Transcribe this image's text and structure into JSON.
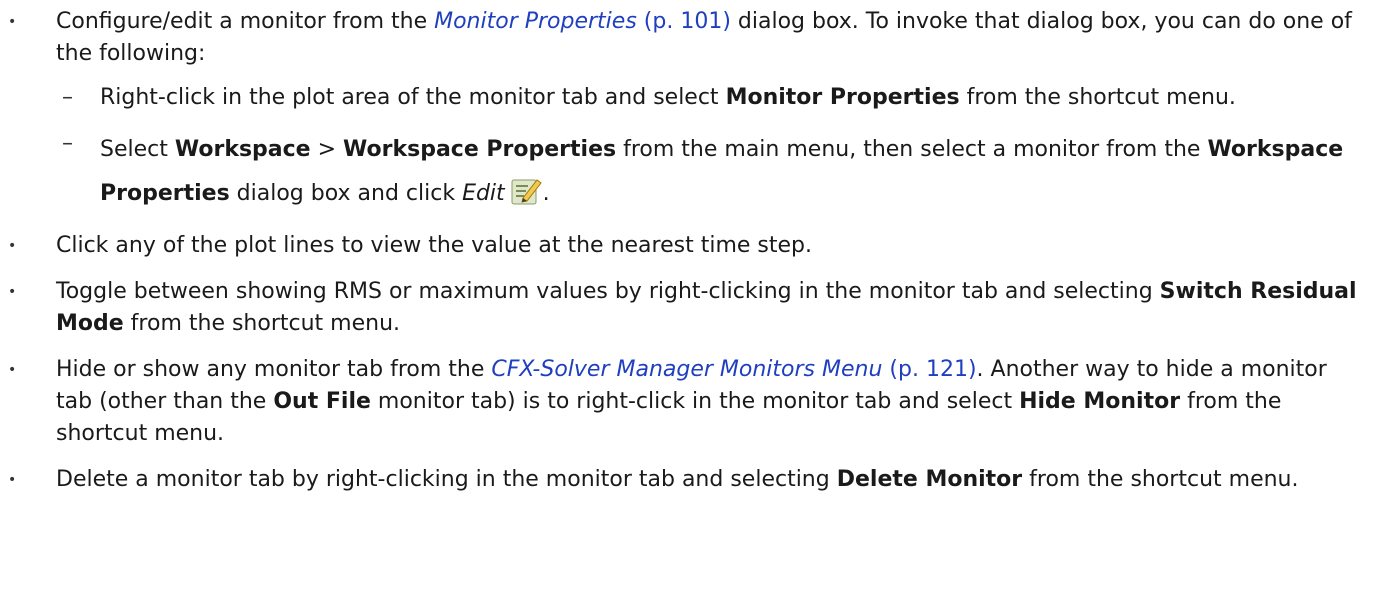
{
  "items": [
    {
      "parts": [
        {
          "t": "Configure/edit a monitor from the "
        },
        {
          "link": "Monitor Properties",
          "page": "(p. 101)"
        },
        {
          "t": " dialog box. To invoke that dialog box, you can do one of the following:"
        }
      ],
      "sub": [
        {
          "parts": [
            {
              "t": "Right-click in the plot area of the monitor tab and select "
            },
            {
              "b": "Monitor Properties"
            },
            {
              "t": " from the shortcut menu."
            }
          ]
        },
        {
          "parts": [
            {
              "t": "Select "
            },
            {
              "b": "Workspace"
            },
            {
              "t": " > "
            },
            {
              "b": "Workspace Properties"
            },
            {
              "t": " from the main menu, then select a monitor from the "
            },
            {
              "b": "Workspace Properties"
            },
            {
              "t": " dialog box and click "
            },
            {
              "i": "Edit"
            },
            {
              "icon": "edit-icon"
            },
            {
              "t": "."
            }
          ]
        }
      ]
    },
    {
      "parts": [
        {
          "t": "Click any of the plot lines to view the value at the nearest time step."
        }
      ]
    },
    {
      "parts": [
        {
          "t": "Toggle between showing RMS or maximum values by right-clicking in the monitor tab and selecting "
        },
        {
          "b": "Switch Residual Mode"
        },
        {
          "t": " from the shortcut menu."
        }
      ]
    },
    {
      "parts": [
        {
          "t": "Hide or show any monitor tab from the "
        },
        {
          "link": "CFX-Solver Manager Monitors Menu",
          "page": "(p. 121)"
        },
        {
          "t": ". Another way to hide a monitor tab (other than the "
        },
        {
          "b": "Out File"
        },
        {
          "t": " monitor tab) is to right-click in the monitor tab and select "
        },
        {
          "b": "Hide Monitor"
        },
        {
          "t": " from the shortcut menu."
        }
      ]
    },
    {
      "parts": [
        {
          "t": "Delete a monitor tab by right-clicking in the monitor tab and selecting "
        },
        {
          "b": "Delete Monitor"
        },
        {
          "t": " from the shortcut menu."
        }
      ]
    }
  ]
}
